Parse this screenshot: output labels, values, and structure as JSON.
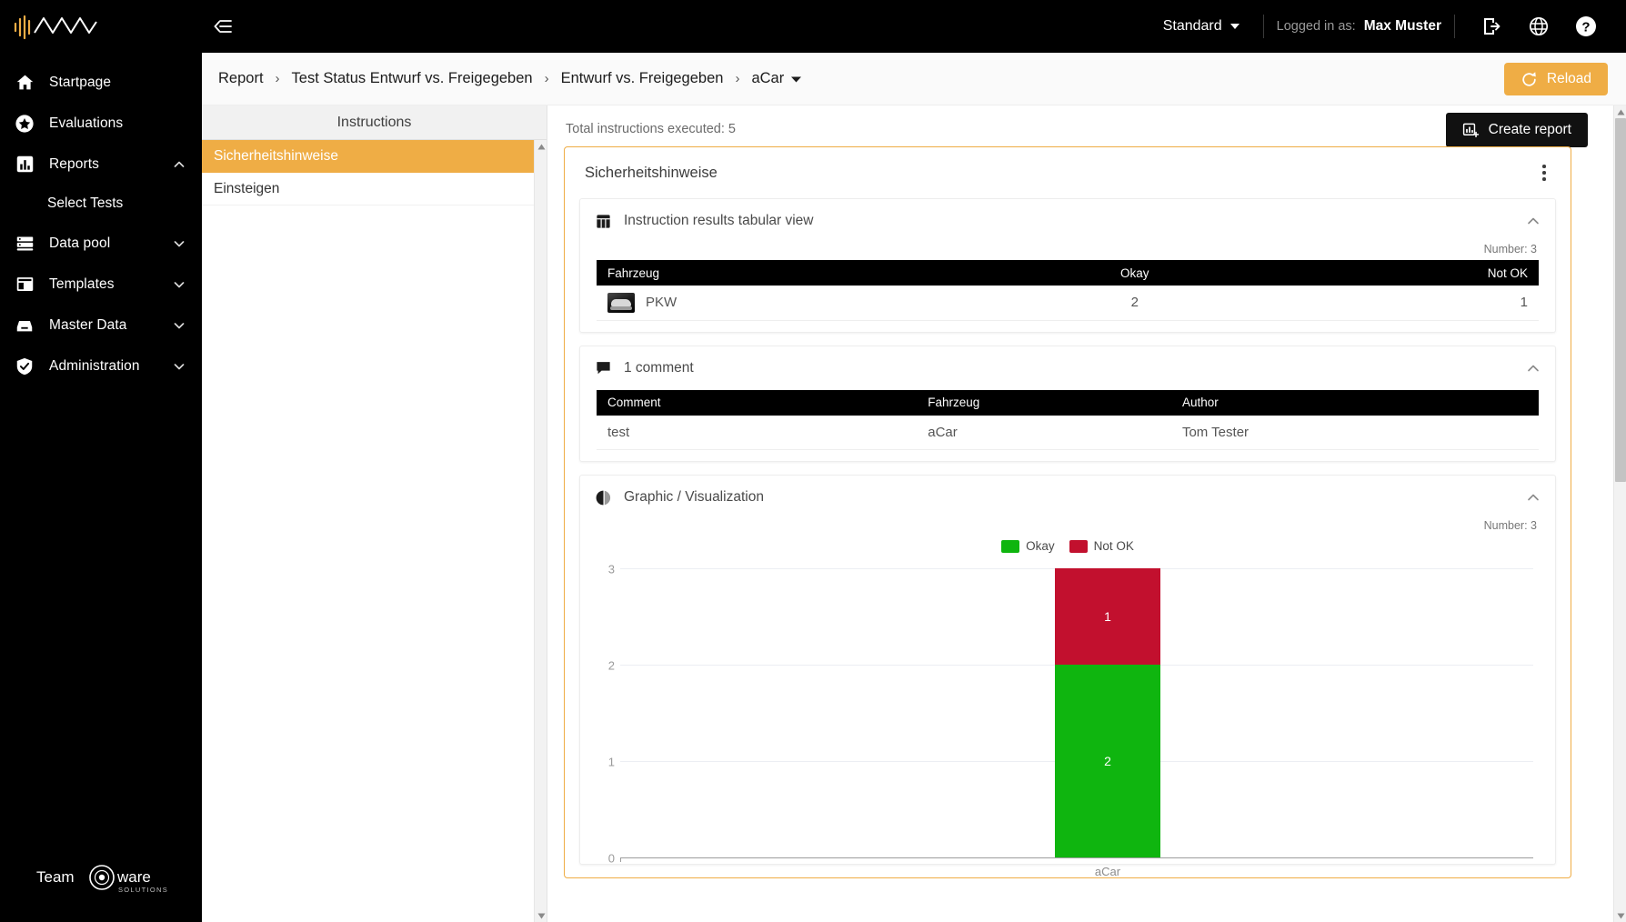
{
  "topbar": {
    "logo_icon": "brand-wave-logo",
    "collapse_icon": "collapse-sidebar-icon",
    "profile_label": "Standard",
    "logged_in_label": "Logged in as:",
    "user_name": "Max Muster",
    "logout_icon": "logout-icon",
    "language_icon": "globe-icon",
    "help_icon": "help-icon"
  },
  "sidebar": {
    "items": [
      {
        "label": "Startpage",
        "icon": "home-icon",
        "expandable": false,
        "chevron": ""
      },
      {
        "label": "Evaluations",
        "icon": "star-icon",
        "expandable": false,
        "chevron": ""
      },
      {
        "label": "Reports",
        "icon": "bar-chart-icon",
        "expandable": true,
        "chevron": "up"
      },
      {
        "label": "Data pool",
        "icon": "database-icon",
        "expandable": true,
        "chevron": "down"
      },
      {
        "label": "Templates",
        "icon": "layout-icon",
        "expandable": true,
        "chevron": "down"
      },
      {
        "label": "Master Data",
        "icon": "inbox-icon",
        "expandable": true,
        "chevron": "down"
      },
      {
        "label": "Administration",
        "icon": "shield-check-icon",
        "expandable": true,
        "chevron": "down"
      }
    ],
    "sub_item": {
      "label": "Select Tests",
      "parent": "Reports"
    },
    "brand": {
      "text_left": "Team",
      "text_right": "ware",
      "tagline": "SOLUTIONS"
    }
  },
  "breadcrumb": {
    "items": [
      "Report",
      "Test Status Entwurf vs. Freigegeben",
      "Entwurf vs. Freigegeben",
      "aCar"
    ],
    "separator": "›",
    "last_has_dropdown": true
  },
  "toolbar": {
    "reload_label": "Reload",
    "reload_icon": "refresh-icon",
    "create_report_label": "Create report",
    "create_report_icon": "chart-add-icon"
  },
  "instructions_panel": {
    "title": "Instructions",
    "items": [
      {
        "label": "Sicherheitshinweise",
        "active": true
      },
      {
        "label": "Einsteigen",
        "active": false
      }
    ]
  },
  "report": {
    "executed_line": "Total instructions executed: 5",
    "card_title": "Sicherheitshinweise",
    "kebab_icon": "more-vertical-icon",
    "sections": [
      {
        "title": "Instruction results tabular view",
        "icon": "table-icon",
        "chevron_icon": "chevron-up-icon",
        "number_note": "Number: 3",
        "columns": [
          "Fahrzeug",
          "Okay",
          "Not OK"
        ],
        "rows": [
          {
            "vehicle": "PKW",
            "vehicle_icon": "car-thumbnail",
            "okay": "2",
            "not_ok": "1"
          }
        ]
      },
      {
        "title": "1 comment",
        "icon": "comment-icon",
        "chevron_icon": "chevron-up-icon",
        "columns": [
          "Comment",
          "Fahrzeug",
          "Author"
        ],
        "rows": [
          {
            "comment": "test",
            "vehicle": "aCar",
            "author": "Tom Tester"
          }
        ]
      },
      {
        "title": "Graphic / Visualization",
        "icon": "pie-chart-icon",
        "chevron_icon": "chevron-up-icon",
        "number_note": "Number: 3"
      }
    ]
  },
  "chart_data": {
    "type": "bar",
    "stacked": true,
    "title": "",
    "xlabel": "",
    "ylabel": "",
    "categories": [
      "aCar"
    ],
    "series": [
      {
        "name": "Okay",
        "values": [
          2
        ],
        "color": "#0fb50f"
      },
      {
        "name": "Not OK",
        "values": [
          1
        ],
        "color": "#c2102e"
      }
    ],
    "ylim": [
      0,
      3
    ],
    "yticks": [
      "0",
      "1",
      "2",
      "3"
    ],
    "grid": true,
    "legend_position": "top-center",
    "bar_labels": {
      "Okay": "2",
      "Not OK": "1"
    }
  },
  "colors": {
    "accent_orange": "#efad45",
    "okay_green": "#0fb50f",
    "notok_red": "#c2102e",
    "sidebar_black": "#000000"
  },
  "scrollbars": {
    "instructions_up_icon": "scroll-up-arrow",
    "instructions_down_icon": "scroll-down-arrow",
    "main_up_icon": "scroll-up-arrow",
    "main_down_icon": "scroll-down-arrow"
  }
}
